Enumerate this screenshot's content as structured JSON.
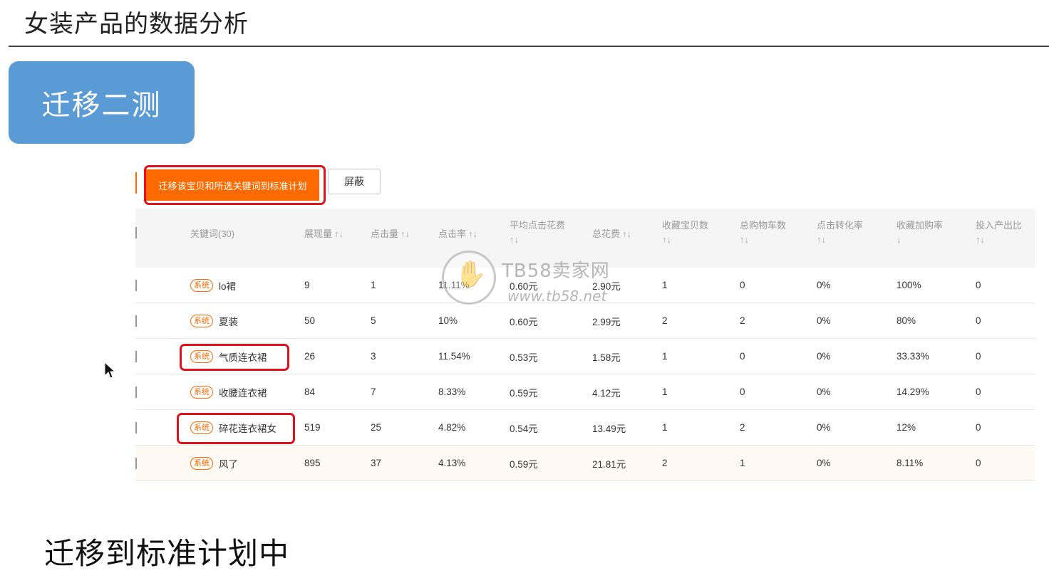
{
  "page": {
    "title": "女装产品的数据分析",
    "badge": "迁移二测",
    "caption": "迁移到标准计划中"
  },
  "toolbar": {
    "migrate_label": "迁移该宝贝和所选关键词到标准计划",
    "shield_label": "屏蔽"
  },
  "table": {
    "headers": [
      {
        "label": "关键词(30)",
        "sort": ""
      },
      {
        "label": "展现量",
        "sort": "↑↓"
      },
      {
        "label": "点击量",
        "sort": "↑↓"
      },
      {
        "label": "点击率",
        "sort": "↑↓"
      },
      {
        "label": "平均点击花费",
        "sort": "↑↓"
      },
      {
        "label": "总花费",
        "sort": "↑↓"
      },
      {
        "label": "收藏宝贝数",
        "sort": "↑↓"
      },
      {
        "label": "总购物车数",
        "sort": "↑↓"
      },
      {
        "label": "点击转化率",
        "sort": "↑↓"
      },
      {
        "label": "收藏加购率",
        "sort": "↓"
      },
      {
        "label": "投入产出比",
        "sort": "↑↓"
      }
    ],
    "tag_label": "系统",
    "rows": [
      {
        "keyword": "lo裙",
        "impressions": "9",
        "clicks": "1",
        "ctr": "11.11%",
        "avg_cpc": "0.60元",
        "total_cost": "2.90元",
        "fav_items": "1",
        "cart": "0",
        "cvr": "0%",
        "fav_cart_rate": "100%",
        "roi": "0"
      },
      {
        "keyword": "夏装",
        "impressions": "50",
        "clicks": "5",
        "ctr": "10%",
        "avg_cpc": "0.60元",
        "total_cost": "2.99元",
        "fav_items": "2",
        "cart": "2",
        "cvr": "0%",
        "fav_cart_rate": "80%",
        "roi": "0"
      },
      {
        "keyword": "气质连衣裙",
        "impressions": "26",
        "clicks": "3",
        "ctr": "11.54%",
        "avg_cpc": "0.53元",
        "total_cost": "1.58元",
        "fav_items": "1",
        "cart": "0",
        "cvr": "0%",
        "fav_cart_rate": "33.33%",
        "roi": "0"
      },
      {
        "keyword": "收腰连衣裙",
        "impressions": "84",
        "clicks": "7",
        "ctr": "8.33%",
        "avg_cpc": "0.59元",
        "total_cost": "4.12元",
        "fav_items": "1",
        "cart": "0",
        "cvr": "0%",
        "fav_cart_rate": "14.29%",
        "roi": "0"
      },
      {
        "keyword": "碎花连衣裙女",
        "impressions": "519",
        "clicks": "25",
        "ctr": "4.82%",
        "avg_cpc": "0.54元",
        "total_cost": "13.49元",
        "fav_items": "1",
        "cart": "2",
        "cvr": "0%",
        "fav_cart_rate": "12%",
        "roi": "0"
      },
      {
        "keyword": "风了",
        "impressions": "895",
        "clicks": "37",
        "ctr": "4.13%",
        "avg_cpc": "0.59元",
        "total_cost": "21.81元",
        "fav_items": "2",
        "cart": "1",
        "cvr": "0%",
        "fav_cart_rate": "8.11%",
        "roi": "0"
      }
    ]
  },
  "watermark": {
    "title": "TB58卖家网",
    "url": "www.tb58.net"
  },
  "colors": {
    "accent": "#ff6a00",
    "badge_bg": "#5b9bd5",
    "highlight": "#e0101c"
  }
}
